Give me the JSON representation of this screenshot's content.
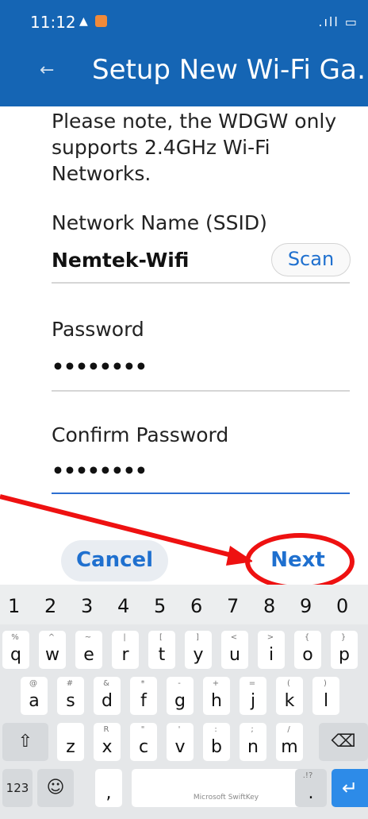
{
  "status_bar": {
    "time": "11:12",
    "alarm_icon": "▲",
    "right_icons": ".ıll ▭"
  },
  "app_bar": {
    "back_icon": "←",
    "title": "Setup New Wi-Fi Ga…"
  },
  "note": "Please note, the WDGW only supports 2.4GHz Wi-Fi Networks.",
  "ssid": {
    "label": "Network Name (SSID)",
    "value": "Nemtek-Wifi",
    "scan": "Scan"
  },
  "password": {
    "label": "Password",
    "value": "••••••••"
  },
  "confirm": {
    "label": "Confirm Password",
    "value": "••••••••"
  },
  "buttons": {
    "cancel": "Cancel",
    "next": "Next"
  },
  "keyboard": {
    "numbers": [
      "1",
      "2",
      "3",
      "4",
      "5",
      "6",
      "7",
      "8",
      "9",
      "0"
    ],
    "row1": [
      [
        "%",
        "q"
      ],
      [
        "^",
        "w"
      ],
      [
        "~",
        "e"
      ],
      [
        "|",
        "r"
      ],
      [
        "[",
        "t"
      ],
      [
        "]",
        "y"
      ],
      [
        "<",
        "u"
      ],
      [
        ">",
        "i"
      ],
      [
        "{",
        "o"
      ],
      [
        "}",
        "p"
      ]
    ],
    "row2": [
      [
        "@",
        "a"
      ],
      [
        "#",
        "s"
      ],
      [
        "&",
        "d"
      ],
      [
        "*",
        "f"
      ],
      [
        "-",
        "g"
      ],
      [
        "+",
        "h"
      ],
      [
        "=",
        "j"
      ],
      [
        "(",
        "k"
      ],
      [
        ")",
        "l"
      ]
    ],
    "row3": [
      [
        "",
        "z"
      ],
      [
        "R",
        "x"
      ],
      [
        "\"",
        "c"
      ],
      [
        "'",
        "v"
      ],
      [
        ":",
        "b"
      ],
      [
        ";",
        "n"
      ],
      [
        "/",
        "m"
      ]
    ],
    "shift": "⇧",
    "delete": "⌫",
    "numbers_key": "123",
    "emoji": "☺",
    "comma": ",",
    "space_label": "Microsoft SwiftKey",
    "period_small": ".!?",
    "period": ".",
    "enter": "↵"
  }
}
